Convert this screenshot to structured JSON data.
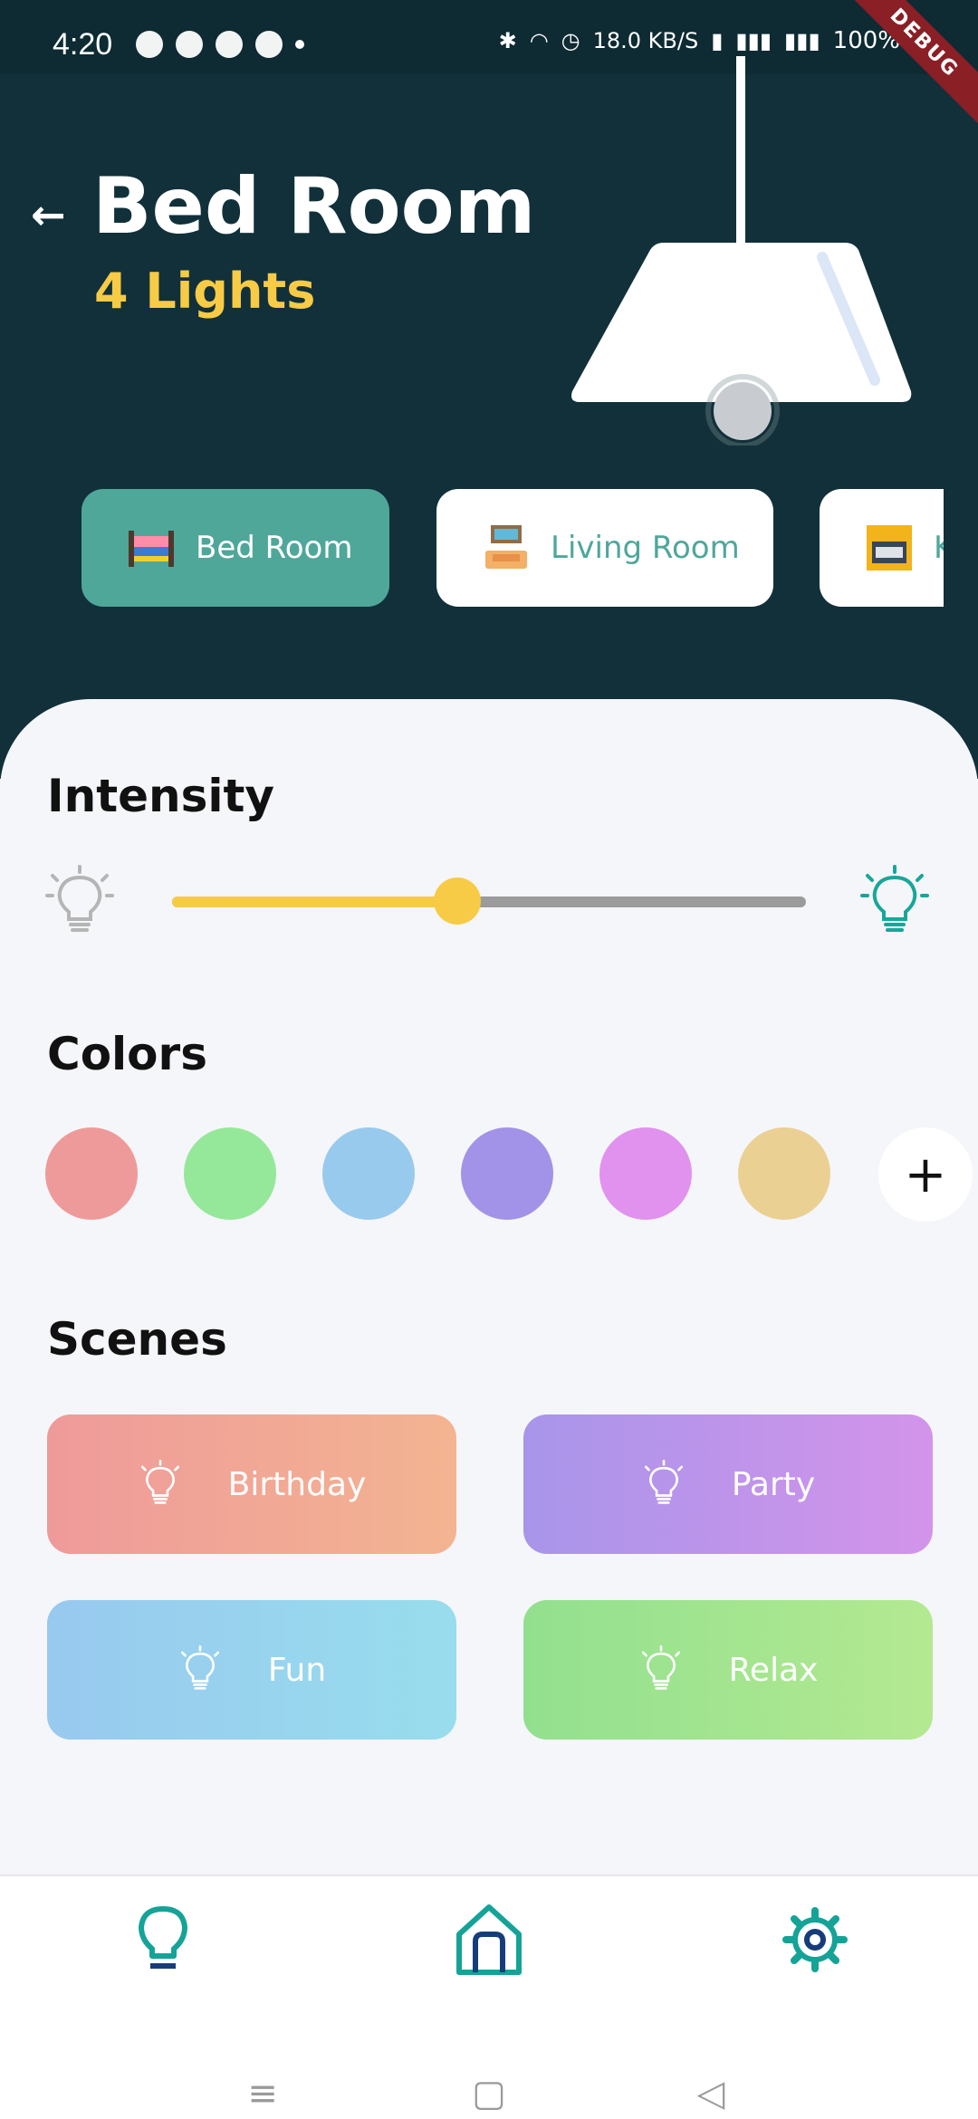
{
  "status_bar": {
    "time": "4:20",
    "network_speed": "18.0 KB/S",
    "battery": "100%",
    "left_icons": [
      "whatsapp-icon",
      "telegram-icon",
      "jio-icon",
      "u-icon"
    ],
    "right_icons": [
      "bluetooth-icon",
      "headphones-icon",
      "alarm-icon",
      "volte-icon",
      "signal-icon",
      "4g-signal-icon"
    ]
  },
  "debug_banner": {
    "label": "DEBUG"
  },
  "header": {
    "title": "Bed Room",
    "subtitle": "4 Lights",
    "colors": {
      "bg": "#11303a",
      "accent": "#f7cb45"
    }
  },
  "rooms": [
    {
      "label": "Bed Room",
      "icon": "bed-icon",
      "active": true
    },
    {
      "label": "Living Room",
      "icon": "living-room-icon",
      "active": false
    },
    {
      "label": "K",
      "icon": "kitchen-icon",
      "active": false
    }
  ],
  "intensity": {
    "title": "Intensity",
    "value": 0.45
  },
  "colors_section": {
    "title": "Colors",
    "swatches": [
      "#ef9a9a",
      "#95e899",
      "#98caed",
      "#a293e8",
      "#e192ee",
      "#ebd094"
    ],
    "add_symbol": "+"
  },
  "scenes": {
    "title": "Scenes",
    "items": [
      {
        "label": "Birthday",
        "from": "#ef9a9a",
        "to": "#f3b491"
      },
      {
        "label": "Party",
        "from": "#a895ea",
        "to": "#d394ea"
      },
      {
        "label": "Fun",
        "from": "#98c9ef",
        "to": "#98dded"
      },
      {
        "label": "Relax",
        "from": "#92e08f",
        "to": "#b4e991"
      }
    ]
  },
  "bottom_nav": [
    "bulb-icon",
    "home-icon",
    "settings-icon"
  ],
  "system_nav": [
    "menu-icon",
    "home-square-icon",
    "back-triangle-icon"
  ]
}
